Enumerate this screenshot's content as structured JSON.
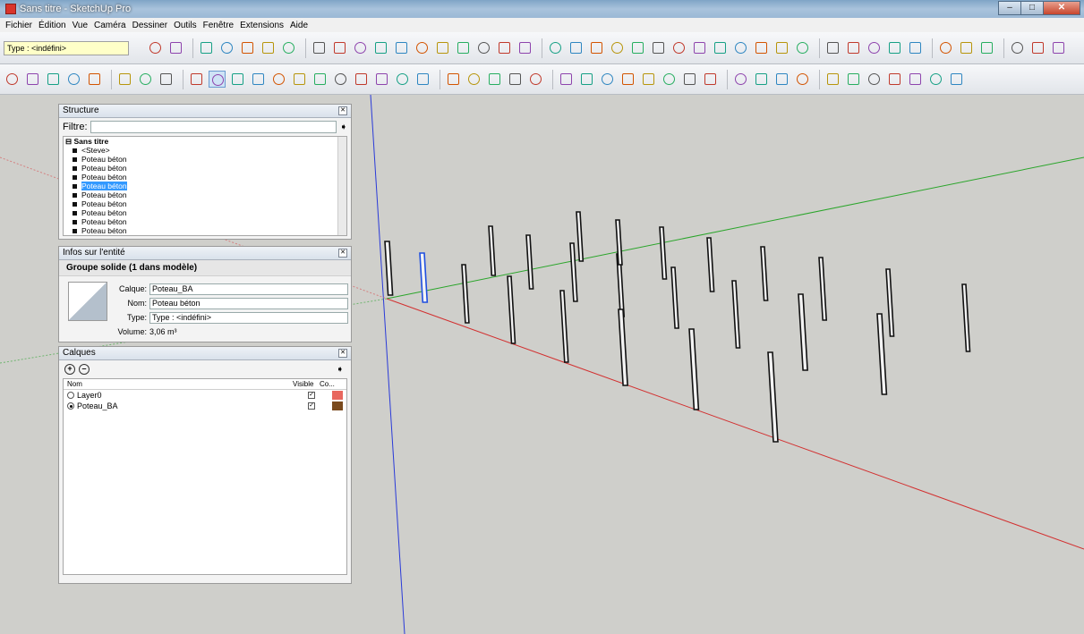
{
  "window": {
    "title": "Sans titre - SketchUp Pro"
  },
  "menu": [
    "Fichier",
    "Édition",
    "Vue",
    "Caméra",
    "Dessiner",
    "Outils",
    "Fenêtre",
    "Extensions",
    "Aide"
  ],
  "toolbar": {
    "type_combo": "Type : <indéfini>"
  },
  "structure": {
    "title": "Structure",
    "filter_label": "Filtre:",
    "filter_value": "",
    "root": "Sans titre",
    "items": [
      "<Steve>",
      "Poteau béton",
      "Poteau béton",
      "Poteau béton",
      "Poteau béton",
      "Poteau béton",
      "Poteau béton",
      "Poteau béton",
      "Poteau béton",
      "Poteau béton"
    ],
    "selected_index": 4
  },
  "entity": {
    "title": "Infos sur l'entité",
    "group": "Groupe solide (1 dans modèle)",
    "calque_label": "Calque:",
    "calque_value": "Poteau_BA",
    "nom_label": "Nom:",
    "nom_value": "Poteau béton",
    "type_label": "Type:",
    "type_value": "Type : <indéfini>",
    "volume_label": "Volume:",
    "volume_value": "3,06 m³"
  },
  "layers": {
    "title": "Calques",
    "col_nom": "Nom",
    "col_visible": "Visible",
    "col_color": "Co...",
    "rows": [
      {
        "name": "Layer0",
        "active": false,
        "visible": true,
        "color": "#e8675e"
      },
      {
        "name": "Poteau_BA",
        "active": true,
        "visible": true,
        "color": "#7a4a1e"
      }
    ]
  },
  "colors": {
    "axis_red": "#d23030",
    "axis_green": "#2aa52a",
    "axis_blue": "#2a3ad8",
    "selected": "#1f4fe0"
  }
}
